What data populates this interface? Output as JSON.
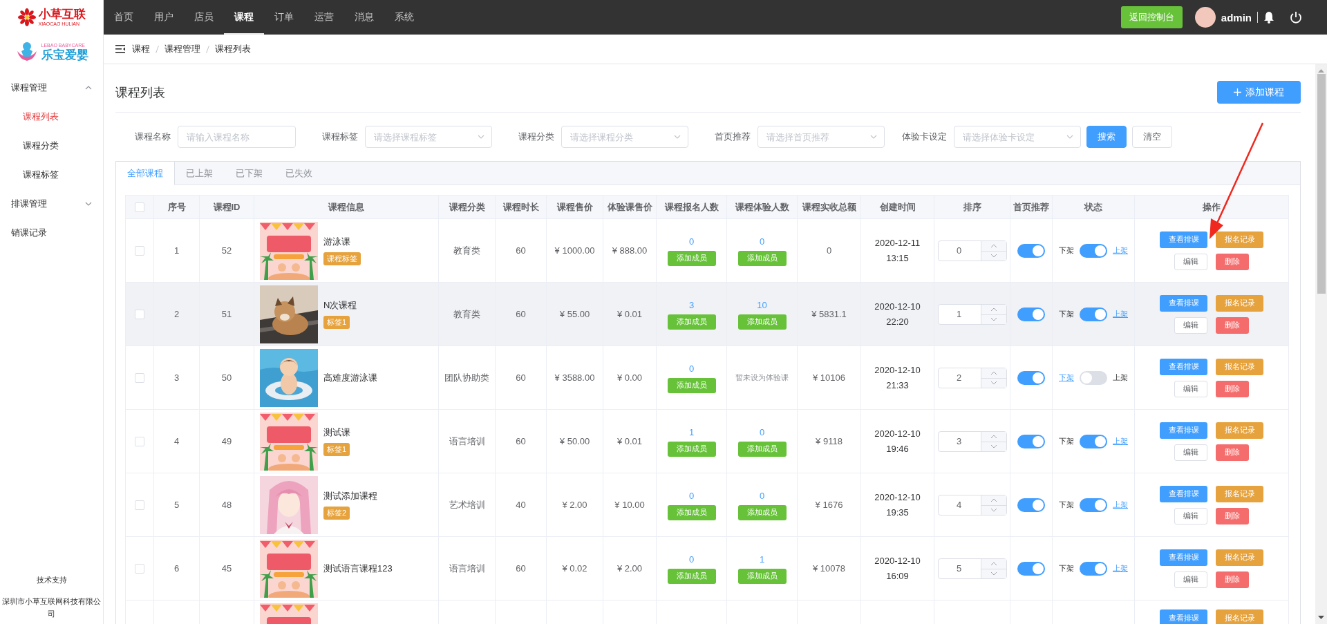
{
  "logos": {
    "brand": {
      "name": "小草互联",
      "subtitle": "XIAOCAO HULIAN"
    },
    "partner": {
      "subtitle": "LEBAO BABYCARE",
      "name": "乐宝爱婴"
    }
  },
  "top_nav": {
    "items": [
      {
        "label": "首页",
        "selected": false
      },
      {
        "label": "用户",
        "selected": false
      },
      {
        "label": "店员",
        "selected": false
      },
      {
        "label": "课程",
        "selected": true
      },
      {
        "label": "订单",
        "selected": false
      },
      {
        "label": "运营",
        "selected": false
      },
      {
        "label": "消息",
        "selected": false
      },
      {
        "label": "系统",
        "selected": false
      }
    ],
    "console_button": "返回控制台",
    "user": "admin"
  },
  "sidebar": {
    "items": [
      {
        "kind": "group",
        "label": "课程管理",
        "expanded": true,
        "children": [
          {
            "label": "课程列表",
            "selected": true
          },
          {
            "label": "课程分类",
            "selected": false
          },
          {
            "label": "课程标签",
            "selected": false
          }
        ]
      },
      {
        "kind": "group",
        "label": "排课管理",
        "expanded": false
      },
      {
        "kind": "link",
        "label": "销课记录",
        "selected": false
      }
    ],
    "footer": {
      "title": "技术支持",
      "company": "深圳市小草互联网科技有限公司"
    }
  },
  "breadcrumb": [
    "课程",
    "课程管理",
    "课程列表"
  ],
  "page": {
    "title": "课程列表",
    "add_button": "添加课程"
  },
  "filters": [
    {
      "kind": "input",
      "label": "课程名称",
      "placeholder": "请输入课程名称"
    },
    {
      "kind": "select",
      "label": "课程标签",
      "placeholder": "请选择课程标签"
    },
    {
      "kind": "select",
      "label": "课程分类",
      "placeholder": "请选择课程分类"
    },
    {
      "kind": "select",
      "label": "首页推荐",
      "placeholder": "请选择首页推荐"
    },
    {
      "kind": "select",
      "label": "体验卡设定",
      "placeholder": "请选择体验卡设定"
    }
  ],
  "search_button": "搜索",
  "clear_button": "清空",
  "tabs": [
    {
      "label": "全部课程",
      "selected": true
    },
    {
      "label": "已上架",
      "selected": false
    },
    {
      "label": "已下架",
      "selected": false
    },
    {
      "label": "已失效",
      "selected": false
    }
  ],
  "table": {
    "header_checked": false,
    "columns": [
      "序号",
      "课程ID",
      "课程信息",
      "课程分类",
      "课程时长",
      "课程售价",
      "体验课售价",
      "课程报名人数",
      "课程体验人数",
      "课程实收总额",
      "创建时间",
      "排序",
      "首页推荐",
      "状态",
      "操作"
    ],
    "rows": [
      {
        "checked": false,
        "hovered": false,
        "index": "1",
        "id": "52",
        "picture": {
          "kind": "picture"
        },
        "name": "游泳课",
        "tag": "课程标签",
        "category": "教育类",
        "duration": "60",
        "price": "¥ 1000.00",
        "trial_price": "¥ 888.00",
        "enroll": {
          "count": "0",
          "button": "添加成员"
        },
        "trial": {
          "kind": "button",
          "count": "0",
          "button": "添加成员"
        },
        "total": "0",
        "created": "2020-12-11 13:15",
        "sort": "0",
        "recommended": true,
        "status": {
          "on": true,
          "off_label": "下架",
          "on_label": "上架"
        },
        "actions": [
          {
            "kind": "primary",
            "label": "查看排课"
          },
          {
            "kind": "warning",
            "label": "报名记录"
          },
          {
            "kind": "plain",
            "label": "编辑"
          },
          {
            "kind": "danger",
            "label": "删除"
          }
        ]
      },
      {
        "checked": false,
        "hovered": true,
        "index": "2",
        "id": "51",
        "picture": {
          "kind": "picture"
        },
        "name": "N次课程",
        "tag": "标签1",
        "category": "教育类",
        "duration": "60",
        "price": "¥ 55.00",
        "trial_price": "¥ 0.01",
        "enroll": {
          "count": "3",
          "button": "添加成员"
        },
        "trial": {
          "kind": "button",
          "count": "10",
          "button": "添加成员"
        },
        "total": "¥ 5831.1",
        "created": "2020-12-10 22:20",
        "sort": "1",
        "recommended": true,
        "status": {
          "on": true,
          "off_label": "下架",
          "on_label": "上架"
        },
        "actions": [
          {
            "kind": "primary",
            "label": "查看排课"
          },
          {
            "kind": "warning",
            "label": "报名记录"
          },
          {
            "kind": "plain",
            "label": "编辑"
          },
          {
            "kind": "danger",
            "label": "删除"
          }
        ]
      },
      {
        "checked": false,
        "hovered": false,
        "index": "3",
        "id": "50",
        "picture": {
          "kind": "picture"
        },
        "name": "高难度游泳课",
        "category": "团队协助类",
        "duration": "60",
        "price": "¥ 3588.00",
        "trial_price": "¥ 0.00",
        "enroll": {
          "count": "0",
          "button": "添加成员"
        },
        "trial": {
          "kind": "note",
          "text": "暂未设为体验课"
        },
        "total": "¥ 10106",
        "created": "2020-12-10 21:33",
        "sort": "2",
        "recommended": true,
        "status": {
          "on": false,
          "off_label": "下架",
          "on_label": "上架"
        },
        "actions": [
          {
            "kind": "primary",
            "label": "查看排课"
          },
          {
            "kind": "warning",
            "label": "报名记录"
          },
          {
            "kind": "plain",
            "label": "编辑"
          },
          {
            "kind": "danger",
            "label": "删除"
          }
        ]
      },
      {
        "checked": false,
        "hovered": false,
        "index": "4",
        "id": "49",
        "picture": {
          "kind": "picture"
        },
        "name": "测试课",
        "tag": "标签1",
        "category": "语言培训",
        "duration": "60",
        "price": "¥ 50.00",
        "trial_price": "¥ 0.01",
        "enroll": {
          "count": "1",
          "button": "添加成员"
        },
        "trial": {
          "kind": "button",
          "count": "0",
          "button": "添加成员"
        },
        "total": "¥ 9118",
        "created": "2020-12-10 19:46",
        "sort": "3",
        "recommended": true,
        "status": {
          "on": true,
          "off_label": "下架",
          "on_label": "上架"
        },
        "actions": [
          {
            "kind": "primary",
            "label": "查看排课"
          },
          {
            "kind": "warning",
            "label": "报名记录"
          },
          {
            "kind": "plain",
            "label": "编辑"
          },
          {
            "kind": "danger",
            "label": "删除"
          }
        ]
      },
      {
        "checked": false,
        "hovered": false,
        "index": "5",
        "id": "48",
        "picture": {
          "kind": "picture"
        },
        "name": "测试添加课程",
        "tag": "标签2",
        "category": "艺术培训",
        "duration": "40",
        "price": "¥ 2.00",
        "trial_price": "¥ 10.00",
        "enroll": {
          "count": "0",
          "button": "添加成员"
        },
        "trial": {
          "kind": "button",
          "count": "0",
          "button": "添加成员"
        },
        "total": "¥ 1676",
        "created": "2020-12-10 19:35",
        "sort": "4",
        "recommended": true,
        "status": {
          "on": true,
          "off_label": "下架",
          "on_label": "上架"
        },
        "actions": [
          {
            "kind": "primary",
            "label": "查看排课"
          },
          {
            "kind": "warning",
            "label": "报名记录"
          },
          {
            "kind": "plain",
            "label": "编辑"
          },
          {
            "kind": "danger",
            "label": "删除"
          }
        ]
      },
      {
        "checked": false,
        "hovered": false,
        "index": "6",
        "id": "45",
        "picture": {
          "kind": "picture"
        },
        "name": "测试语言课程123",
        "category": "语言培训",
        "duration": "60",
        "price": "¥ 0.02",
        "trial_price": "¥ 2.00",
        "enroll": {
          "count": "0",
          "button": "添加成员"
        },
        "trial": {
          "kind": "button",
          "count": "1",
          "button": "添加成员"
        },
        "total": "¥ 10078",
        "created": "2020-12-10 16:09",
        "sort": "5",
        "recommended": true,
        "status": {
          "on": true,
          "off_label": "下架",
          "on_label": "上架"
        },
        "actions": [
          {
            "kind": "primary",
            "label": "查看排课"
          },
          {
            "kind": "warning",
            "label": "报名记录"
          },
          {
            "kind": "plain",
            "label": "编辑"
          },
          {
            "kind": "danger",
            "label": "删除"
          }
        ]
      },
      {
        "cut_off": true,
        "picture": {
          "kind": "picture"
        },
        "actions": [
          {
            "kind": "primary",
            "label": "查看排课"
          },
          {
            "kind": "warning",
            "label": "报名记录"
          }
        ]
      }
    ]
  }
}
